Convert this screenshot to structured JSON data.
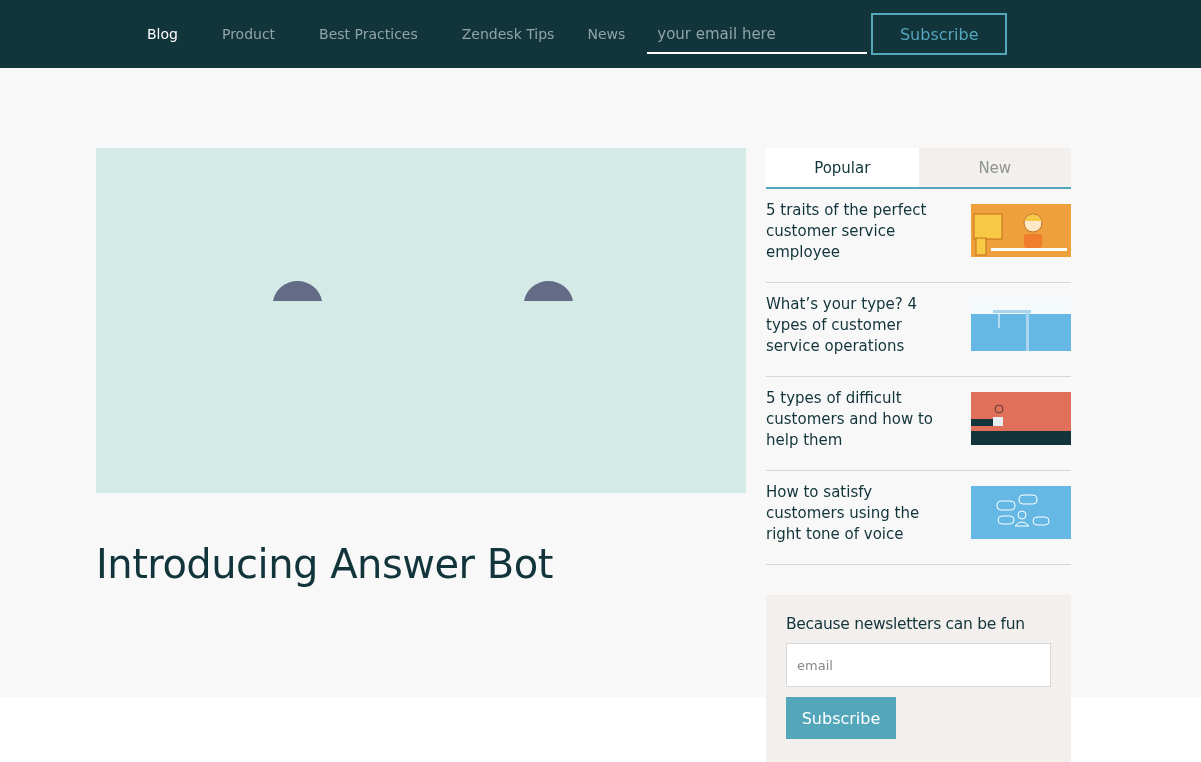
{
  "nav": {
    "items": [
      {
        "label": "Blog",
        "selected": true
      },
      {
        "label": "Product",
        "selected": false
      },
      {
        "label": "Best Practices",
        "selected": false
      },
      {
        "label": "Zendesk Tips",
        "selected": false
      },
      {
        "label": "News",
        "selected": false
      }
    ],
    "email": {
      "placeholder": "your email here"
    },
    "subscribe": "Subscribe"
  },
  "hero": {
    "title": "Introducing Answer Bot"
  },
  "sidebar": {
    "tabs": [
      {
        "label": "Popular",
        "selected": true
      },
      {
        "label": "New",
        "selected": false
      }
    ],
    "articles": [
      {
        "title": "5 traits of the perfect customer service employee",
        "kind": "agent"
      },
      {
        "title": "What’s your type? 4 types of customer service operations",
        "kind": "crane"
      },
      {
        "title": "5 types of difficult customers and how to help them",
        "kind": "plant"
      },
      {
        "title": "How to satisfy customers using the right tone of voice",
        "kind": "chat"
      }
    ]
  },
  "newsletter": {
    "heading": "Because newsletters can be fun",
    "email": {
      "placeholder": "email"
    },
    "subscribe": "Subscribe"
  }
}
